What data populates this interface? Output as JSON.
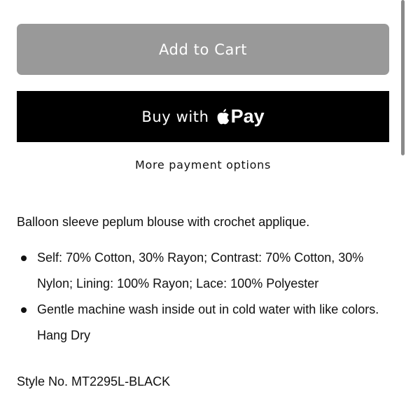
{
  "buttons": {
    "add_to_cart": "Add to Cart",
    "buy_with": "Buy with",
    "pay_brand": "Pay",
    "more_payment_options": "More payment options"
  },
  "product": {
    "description": "Balloon sleeve peplum blouse with crochet applique.",
    "details": [
      "Self: 70% Cotton, 30% Rayon; Contrast: 70% Cotton, 30% Nylon; Lining: 100% Rayon; Lace: 100% Polyester",
      "Gentle machine wash inside out in cold water with like colors. Hang Dry"
    ],
    "style_number": "Style No. MT2295L-BLACK"
  },
  "icons": {
    "apple_logo": "apple-logo-icon",
    "bullet": "bullet-icon"
  },
  "colors": {
    "add_to_cart_bg": "#999999",
    "buy_now_bg": "#000000",
    "button_text": "#ffffff",
    "body_text": "#111111"
  }
}
